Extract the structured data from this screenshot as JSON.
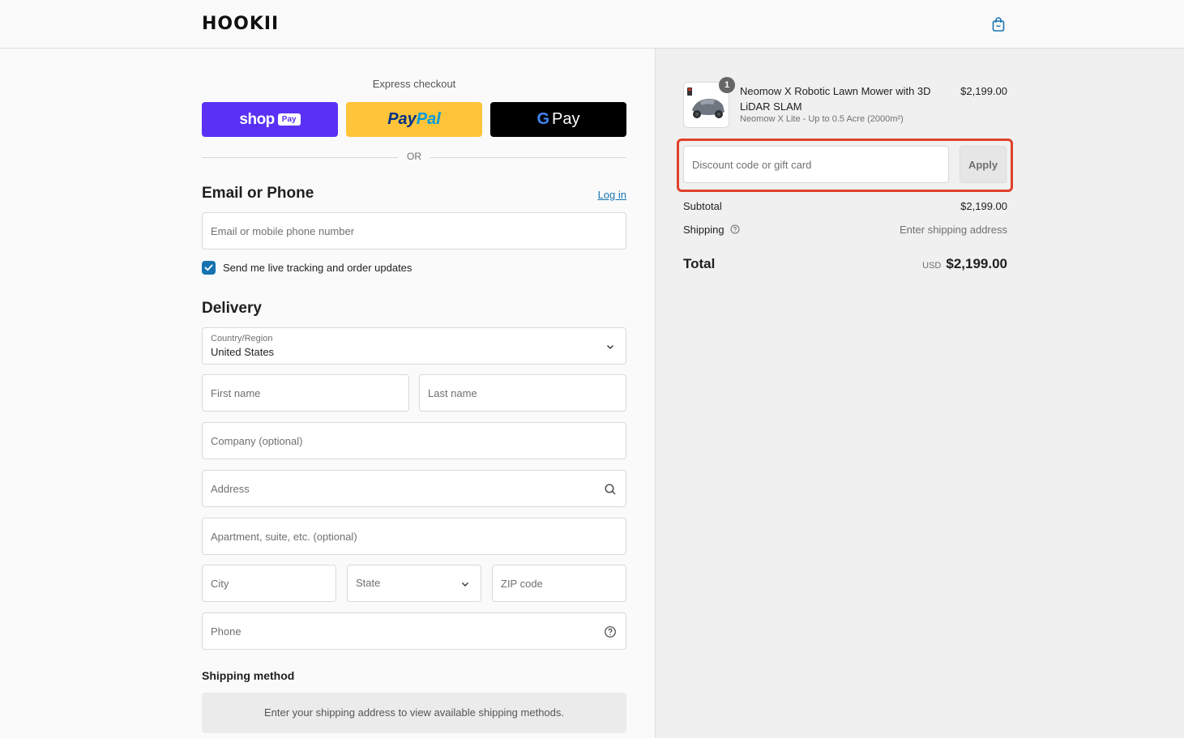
{
  "header": {
    "logo_text": "HOOKII",
    "cart_icon": "shopping-bag-icon"
  },
  "express": {
    "title": "Express checkout",
    "shop_pay": {
      "brand": "shop",
      "pill": "Pay"
    },
    "paypal": {
      "part1": "Pay",
      "part2": "Pal"
    },
    "gpay": {
      "g": "G",
      "label": "Pay"
    },
    "or": "OR"
  },
  "contact": {
    "title": "Email or Phone",
    "login_label": "Log in",
    "email_placeholder": "Email or mobile phone number",
    "updates_label": "Send me live tracking and order updates",
    "updates_checked": true
  },
  "delivery": {
    "title": "Delivery",
    "country_label": "Country/Region",
    "country_value": "United States",
    "first_name": "First name",
    "last_name": "Last name",
    "company": "Company (optional)",
    "address": "Address",
    "apartment": "Apartment, suite, etc. (optional)",
    "city": "City",
    "state": "State",
    "zip": "ZIP code",
    "phone": "Phone"
  },
  "shipping_method": {
    "title": "Shipping method",
    "message": "Enter your shipping address to view available shipping methods."
  },
  "order": {
    "product": {
      "name": "Neomow X Robotic Lawn Mower with 3D LiDAR SLAM",
      "variant": "Neomow X Lite - Up to 0.5 Acre (2000m²)",
      "price": "$2,199.00",
      "quantity": "1"
    },
    "discount_placeholder": "Discount code or gift card",
    "apply_label": "Apply",
    "subtotal_label": "Subtotal",
    "subtotal_value": "$2,199.00",
    "shipping_label": "Shipping",
    "shipping_value": "Enter shipping address",
    "total_label": "Total",
    "total_currency": "USD",
    "total_value": "$2,199.00"
  },
  "colors": {
    "shop_pay": "#5a31f4",
    "paypal": "#ffc439",
    "link": "#1773b0",
    "highlight": "#e0402a"
  }
}
